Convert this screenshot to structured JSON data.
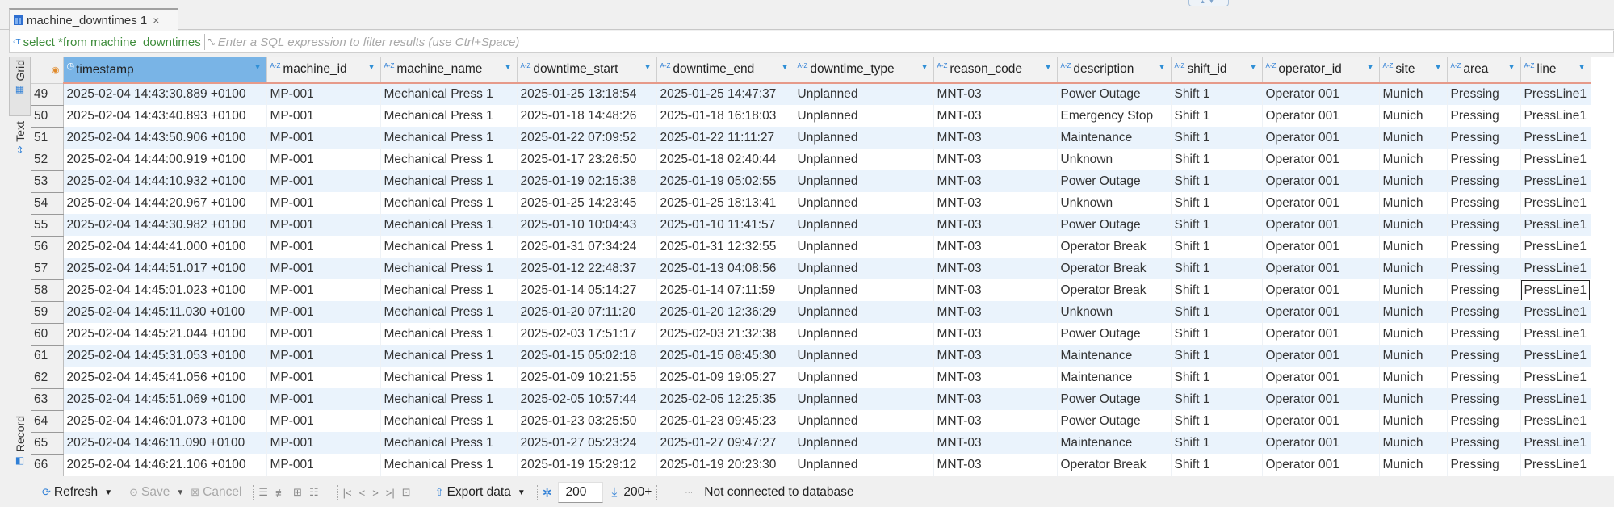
{
  "tab": {
    "icon": "table-icon",
    "title": "machine_downtimes 1",
    "close": "×"
  },
  "filter": {
    "query": "select *from machine_downtimes",
    "placeholder": "Enter a SQL expression to filter results (use Ctrl+Space)"
  },
  "side_tabs": {
    "grid": "Grid",
    "text": "Text",
    "record": "Record"
  },
  "columns": [
    {
      "name": "timestamp",
      "type_icon": "clock-icon"
    },
    {
      "name": "machine_id",
      "type_icon": "A-Z"
    },
    {
      "name": "machine_name",
      "type_icon": "A-Z"
    },
    {
      "name": "downtime_start",
      "type_icon": "A-Z"
    },
    {
      "name": "downtime_end",
      "type_icon": "A-Z"
    },
    {
      "name": "downtime_type",
      "type_icon": "A-Z"
    },
    {
      "name": "reason_code",
      "type_icon": "A-Z"
    },
    {
      "name": "description",
      "type_icon": "A-Z"
    },
    {
      "name": "shift_id",
      "type_icon": "A-Z"
    },
    {
      "name": "operator_id",
      "type_icon": "A-Z"
    },
    {
      "name": "site",
      "type_icon": "A-Z"
    },
    {
      "name": "area",
      "type_icon": "A-Z"
    },
    {
      "name": "line",
      "type_icon": "A-Z"
    }
  ],
  "rows": [
    {
      "n": "49",
      "cells": [
        "2025-02-04 14:43:30.889 +0100",
        "MP-001",
        "Mechanical Press 1",
        "2025-01-25 13:18:54",
        "2025-01-25 14:47:37",
        "Unplanned",
        "MNT-03",
        "Power Outage",
        "Shift 1",
        "Operator 001",
        "Munich",
        "Pressing",
        "PressLine1"
      ]
    },
    {
      "n": "50",
      "cells": [
        "2025-02-04 14:43:40.893 +0100",
        "MP-001",
        "Mechanical Press 1",
        "2025-01-18 14:48:26",
        "2025-01-18 16:18:03",
        "Unplanned",
        "MNT-03",
        "Emergency Stop",
        "Shift 1",
        "Operator 001",
        "Munich",
        "Pressing",
        "PressLine1"
      ]
    },
    {
      "n": "51",
      "cells": [
        "2025-02-04 14:43:50.906 +0100",
        "MP-001",
        "Mechanical Press 1",
        "2025-01-22 07:09:52",
        "2025-01-22 11:11:27",
        "Unplanned",
        "MNT-03",
        "Maintenance",
        "Shift 1",
        "Operator 001",
        "Munich",
        "Pressing",
        "PressLine1"
      ]
    },
    {
      "n": "52",
      "cells": [
        "2025-02-04 14:44:00.919 +0100",
        "MP-001",
        "Mechanical Press 1",
        "2025-01-17 23:26:50",
        "2025-01-18 02:40:44",
        "Unplanned",
        "MNT-03",
        "Unknown",
        "Shift 1",
        "Operator 001",
        "Munich",
        "Pressing",
        "PressLine1"
      ]
    },
    {
      "n": "53",
      "cells": [
        "2025-02-04 14:44:10.932 +0100",
        "MP-001",
        "Mechanical Press 1",
        "2025-01-19 02:15:38",
        "2025-01-19 05:02:55",
        "Unplanned",
        "MNT-03",
        "Power Outage",
        "Shift 1",
        "Operator 001",
        "Munich",
        "Pressing",
        "PressLine1"
      ]
    },
    {
      "n": "54",
      "cells": [
        "2025-02-04 14:44:20.967 +0100",
        "MP-001",
        "Mechanical Press 1",
        "2025-01-25 14:23:45",
        "2025-01-25 18:13:41",
        "Unplanned",
        "MNT-03",
        "Unknown",
        "Shift 1",
        "Operator 001",
        "Munich",
        "Pressing",
        "PressLine1"
      ]
    },
    {
      "n": "55",
      "cells": [
        "2025-02-04 14:44:30.982 +0100",
        "MP-001",
        "Mechanical Press 1",
        "2025-01-10 10:04:43",
        "2025-01-10 11:41:57",
        "Unplanned",
        "MNT-03",
        "Power Outage",
        "Shift 1",
        "Operator 001",
        "Munich",
        "Pressing",
        "PressLine1"
      ]
    },
    {
      "n": "56",
      "cells": [
        "2025-02-04 14:44:41.000 +0100",
        "MP-001",
        "Mechanical Press 1",
        "2025-01-31 07:34:24",
        "2025-01-31 12:32:55",
        "Unplanned",
        "MNT-03",
        "Operator Break",
        "Shift 1",
        "Operator 001",
        "Munich",
        "Pressing",
        "PressLine1"
      ]
    },
    {
      "n": "57",
      "cells": [
        "2025-02-04 14:44:51.017 +0100",
        "MP-001",
        "Mechanical Press 1",
        "2025-01-12 22:48:37",
        "2025-01-13 04:08:56",
        "Unplanned",
        "MNT-03",
        "Operator Break",
        "Shift 1",
        "Operator 001",
        "Munich",
        "Pressing",
        "PressLine1"
      ]
    },
    {
      "n": "58",
      "cells": [
        "2025-02-04 14:45:01.023 +0100",
        "MP-001",
        "Mechanical Press 1",
        "2025-01-14 05:14:27",
        "2025-01-14 07:11:59",
        "Unplanned",
        "MNT-03",
        "Operator Break",
        "Shift 1",
        "Operator 001",
        "Munich",
        "Pressing",
        "PressLine1"
      ]
    },
    {
      "n": "59",
      "cells": [
        "2025-02-04 14:45:11.030 +0100",
        "MP-001",
        "Mechanical Press 1",
        "2025-01-20 07:11:20",
        "2025-01-20 12:36:29",
        "Unplanned",
        "MNT-03",
        "Unknown",
        "Shift 1",
        "Operator 001",
        "Munich",
        "Pressing",
        "PressLine1"
      ]
    },
    {
      "n": "60",
      "cells": [
        "2025-02-04 14:45:21.044 +0100",
        "MP-001",
        "Mechanical Press 1",
        "2025-02-03 17:51:17",
        "2025-02-03 21:32:38",
        "Unplanned",
        "MNT-03",
        "Power Outage",
        "Shift 1",
        "Operator 001",
        "Munich",
        "Pressing",
        "PressLine1"
      ]
    },
    {
      "n": "61",
      "cells": [
        "2025-02-04 14:45:31.053 +0100",
        "MP-001",
        "Mechanical Press 1",
        "2025-01-15 05:02:18",
        "2025-01-15 08:45:30",
        "Unplanned",
        "MNT-03",
        "Maintenance",
        "Shift 1",
        "Operator 001",
        "Munich",
        "Pressing",
        "PressLine1"
      ]
    },
    {
      "n": "62",
      "cells": [
        "2025-02-04 14:45:41.056 +0100",
        "MP-001",
        "Mechanical Press 1",
        "2025-01-09 10:21:55",
        "2025-01-09 19:05:27",
        "Unplanned",
        "MNT-03",
        "Maintenance",
        "Shift 1",
        "Operator 001",
        "Munich",
        "Pressing",
        "PressLine1"
      ]
    },
    {
      "n": "63",
      "cells": [
        "2025-02-04 14:45:51.069 +0100",
        "MP-001",
        "Mechanical Press 1",
        "2025-02-05 10:57:44",
        "2025-02-05 12:25:35",
        "Unplanned",
        "MNT-03",
        "Power Outage",
        "Shift 1",
        "Operator 001",
        "Munich",
        "Pressing",
        "PressLine1"
      ]
    },
    {
      "n": "64",
      "cells": [
        "2025-02-04 14:46:01.073 +0100",
        "MP-001",
        "Mechanical Press 1",
        "2025-01-23 03:25:50",
        "2025-01-23 09:45:23",
        "Unplanned",
        "MNT-03",
        "Power Outage",
        "Shift 1",
        "Operator 001",
        "Munich",
        "Pressing",
        "PressLine1"
      ]
    },
    {
      "n": "65",
      "cells": [
        "2025-02-04 14:46:11.090 +0100",
        "MP-001",
        "Mechanical Press 1",
        "2025-01-27 05:23:24",
        "2025-01-27 09:47:27",
        "Unplanned",
        "MNT-03",
        "Maintenance",
        "Shift 1",
        "Operator 001",
        "Munich",
        "Pressing",
        "PressLine1"
      ]
    },
    {
      "n": "66",
      "cells": [
        "2025-02-04 14:46:21.106 +0100",
        "MP-001",
        "Mechanical Press 1",
        "2025-01-19 15:29:12",
        "2025-01-19 20:23:30",
        "Unplanned",
        "MNT-03",
        "Operator Break",
        "Shift 1",
        "Operator 001",
        "Munich",
        "Pressing",
        "PressLine1"
      ]
    }
  ],
  "selected_cell": {
    "row": "58",
    "column": "line"
  },
  "toolbar": {
    "refresh": "Refresh",
    "save": "Save",
    "cancel": "Cancel",
    "export": "Export data",
    "fetch_size": "200",
    "fetch_count": "200+",
    "status": "Not connected to database"
  },
  "colors": {
    "accent": "#2f7fd6",
    "selected_header": "#79b4e6",
    "row_stripe": "#eaf3fc",
    "query_text": "#3d8c3a"
  }
}
